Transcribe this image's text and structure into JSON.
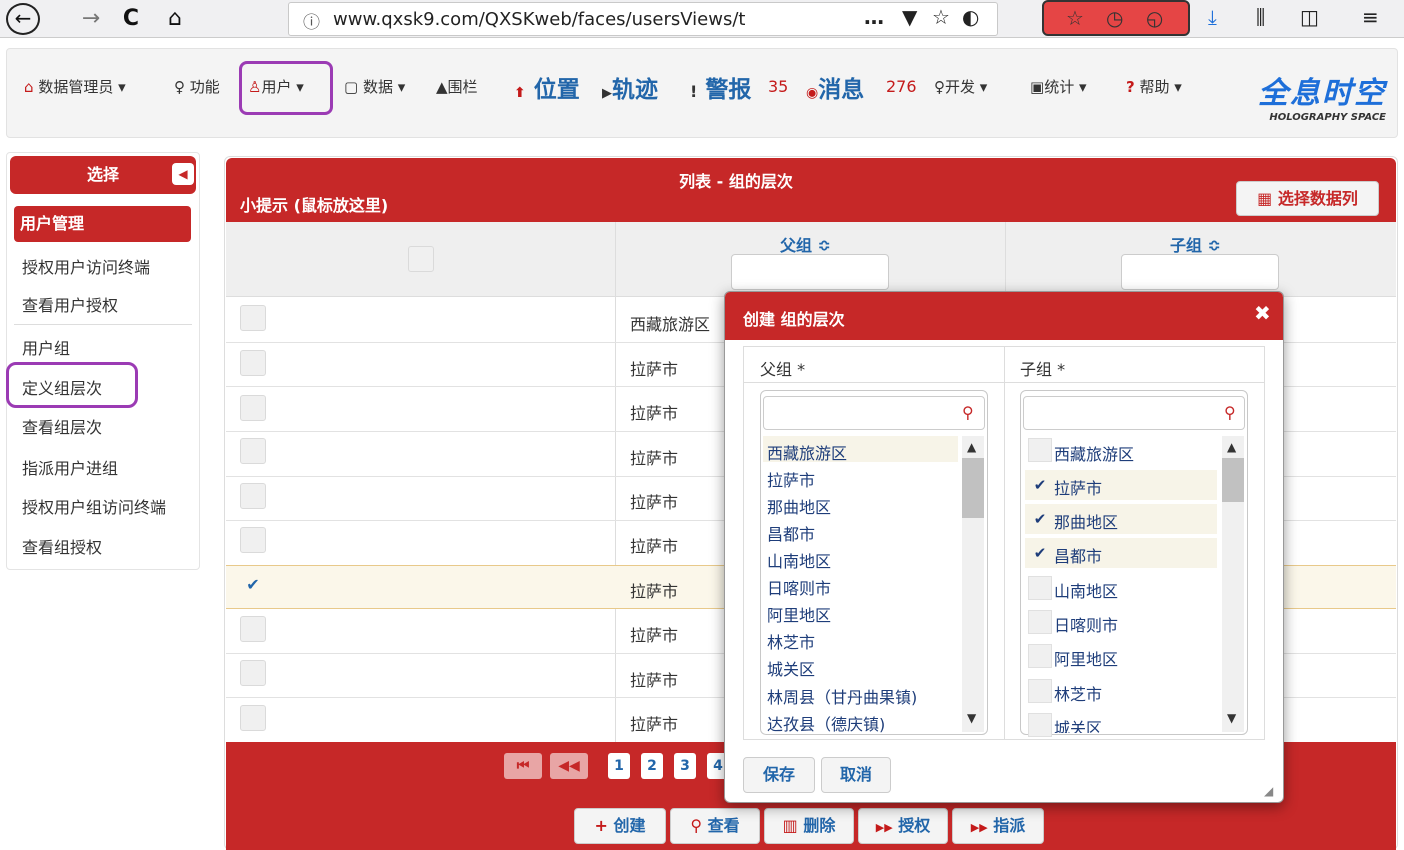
{
  "browser": {
    "url": "www.qxsk9.com/QXSKweb/faces/usersViews/t",
    "more": "…"
  },
  "nav": {
    "admin": "数据管理员",
    "func": "功能",
    "user": "用户",
    "data": "数据",
    "fence": "围栏",
    "location": "位置",
    "track": "轨迹",
    "alarm": "警报",
    "alarm_count": "35",
    "message": "消息",
    "message_count": "276",
    "dev": "开发",
    "stats": "统计",
    "help": "帮助",
    "logo": "全息时空",
    "logo_sub": "HOLOGRAPHY SPACE"
  },
  "sidebar": {
    "header": "选择",
    "items": [
      "用户管理",
      "授权用户访问终端",
      "查看用户授权",
      "用户组",
      "定义组层次",
      "查看组层次",
      "指派用户进组",
      "授权用户组访问终端",
      "查看组授权"
    ]
  },
  "panel": {
    "title": "列表 - 组的层次",
    "hint": "小提示 (鼠标放这里)",
    "select_columns": "选择数据列",
    "col_parent": "父组 ≎",
    "col_child": "子组 ≎",
    "rows": [
      "西藏旅游区",
      "拉萨市",
      "拉萨市",
      "拉萨市",
      "拉萨市",
      "拉萨市",
      "拉萨市",
      "拉萨市",
      "拉萨市",
      "拉萨市"
    ],
    "pages": [
      "1",
      "2",
      "3",
      "4"
    ],
    "actions": {
      "create": "创建",
      "view": "查看",
      "delete": "删除",
      "grant": "授权",
      "assign": "指派"
    }
  },
  "modal": {
    "title": "创建 组的层次",
    "parent_label": "父组 *",
    "child_label": "子组 *",
    "parent_options": [
      "西藏旅游区",
      "拉萨市",
      "那曲地区",
      "昌都市",
      "山南地区",
      "日喀则市",
      "阿里地区",
      "林芝市",
      "城关区",
      "林周县（甘丹曲果镇)",
      "达孜县（德庆镇)"
    ],
    "child_options": [
      "西藏旅游区",
      "拉萨市",
      "那曲地区",
      "昌都市",
      "山南地区",
      "日喀则市",
      "阿里地区",
      "林芝市",
      "城关区"
    ],
    "child_checked": [
      false,
      true,
      true,
      true,
      false,
      false,
      false,
      false,
      false
    ],
    "save": "保存",
    "cancel": "取消"
  },
  "colors": {
    "brand_red": "#c62828",
    "link_blue": "#2266aa",
    "highlight_purple": "#9b3bb4"
  }
}
